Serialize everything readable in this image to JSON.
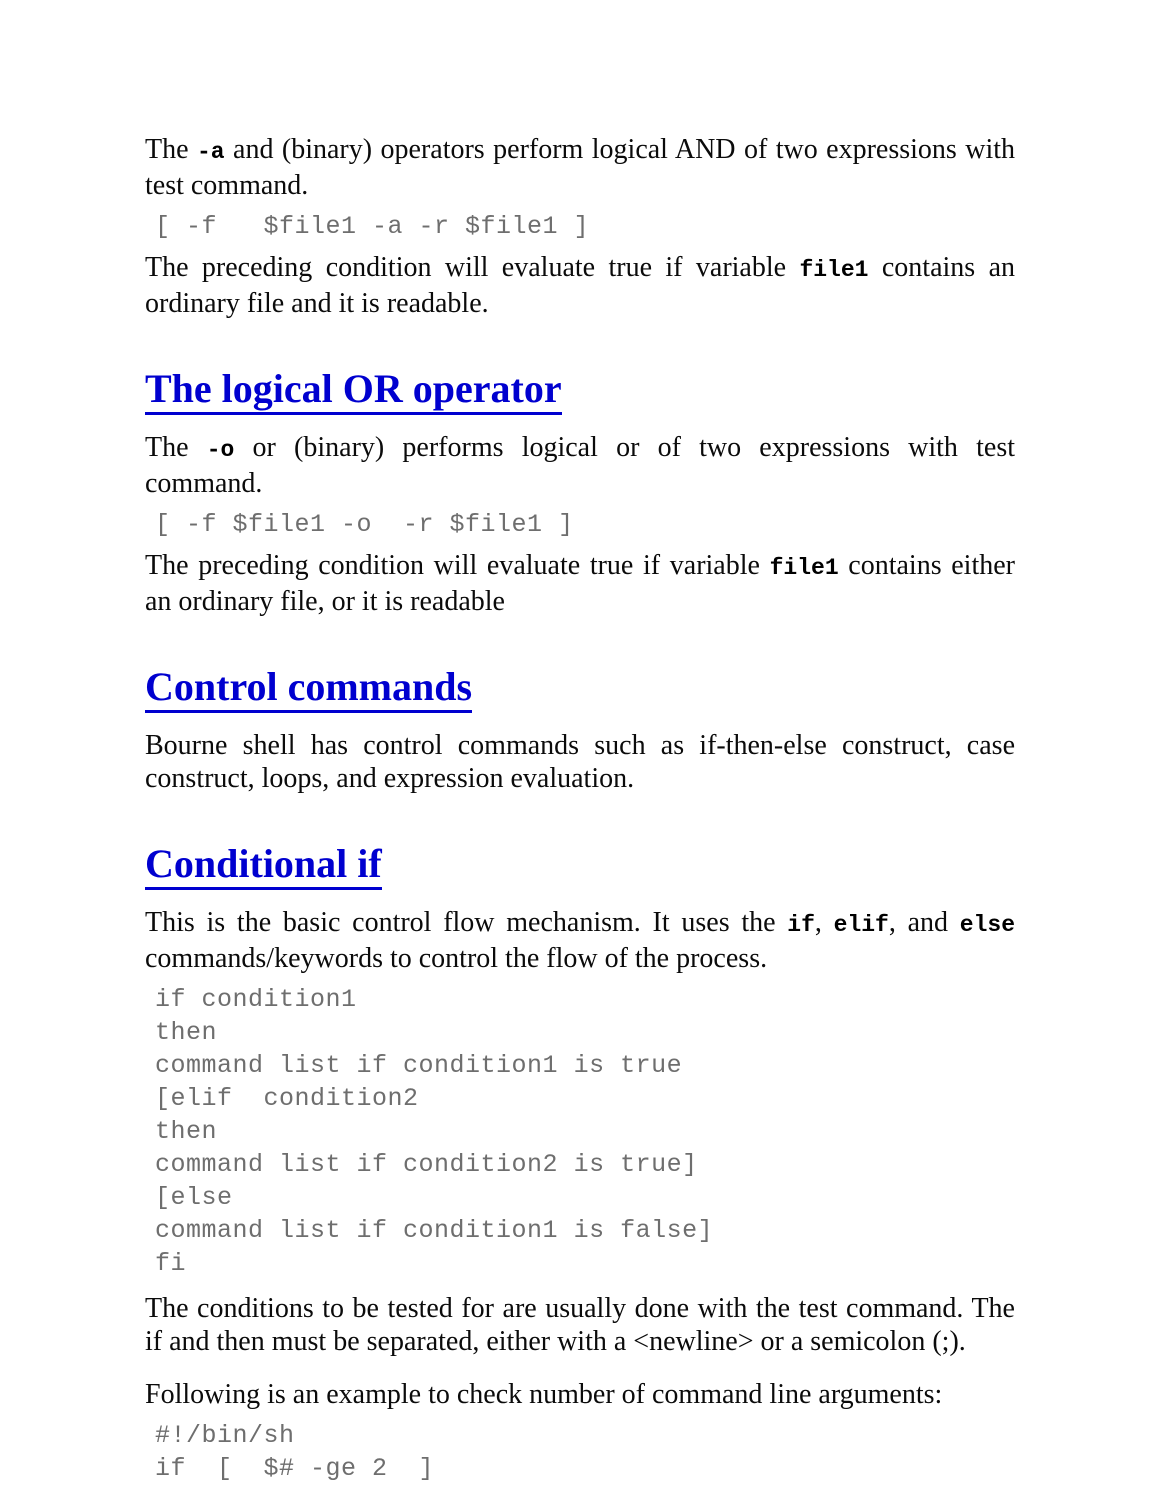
{
  "page": {
    "background_color": "#ffffff",
    "text_color": "#000000",
    "heading_color": "#0000cf",
    "code_color": "#6e6e6e"
  },
  "sections": {
    "and_operator": {
      "paragraph1_part1": "The ",
      "paragraph1_token": "-a",
      "paragraph1_part2": " and (binary) operators perform logical AND of two expressions with test command.",
      "code": "[ -f   $file1 -a -r $file1 ]",
      "paragraph2_part1": "The preceding condition will evaluate true if variable ",
      "paragraph2_token": "file1",
      "paragraph2_part2": " contains an ordinary file and it is readable."
    },
    "or_operator": {
      "heading": "The logical OR operator",
      "paragraph1_part1": "The ",
      "paragraph1_token": "-o",
      "paragraph1_part2": " or (binary) performs logical or of two expressions with test command.",
      "code": "[ -f $file1 -o  -r $file1 ]",
      "paragraph2_part1": "The preceding condition will evaluate true if variable ",
      "paragraph2_token": "file1",
      "paragraph2_part2": " contains either an ordinary file, or it is readable"
    },
    "control_commands": {
      "heading": "Control commands",
      "paragraph1": "Bourne shell has control commands such as if-then-else construct, case construct, loops, and expression evaluation."
    },
    "conditional_if": {
      "heading": "Conditional if",
      "paragraph1_part1": "This is the basic control flow mechanism. It uses the ",
      "paragraph1_token1": "if",
      "paragraph1_sep1": ", ",
      "paragraph1_token2": "elif",
      "paragraph1_sep2": ", and ",
      "paragraph1_token3": "else",
      "paragraph1_part2": " commands/keywords to control the flow of the process.",
      "code_block": "if condition1\nthen\ncommand list if condition1 is true\n[elif  condition2\nthen\ncommand list if condition2 is true]\n[else\ncommand list if condition1 is false]\nfi",
      "paragraph2": "The conditions to be tested for are usually done with the test command. The if and then must be separated, either with a <newline> or a semicolon (;).",
      "paragraph3": "Following is an example to check number of command line arguments:",
      "code_example": "#!/bin/sh\nif  [  $# -ge 2  ]"
    }
  }
}
